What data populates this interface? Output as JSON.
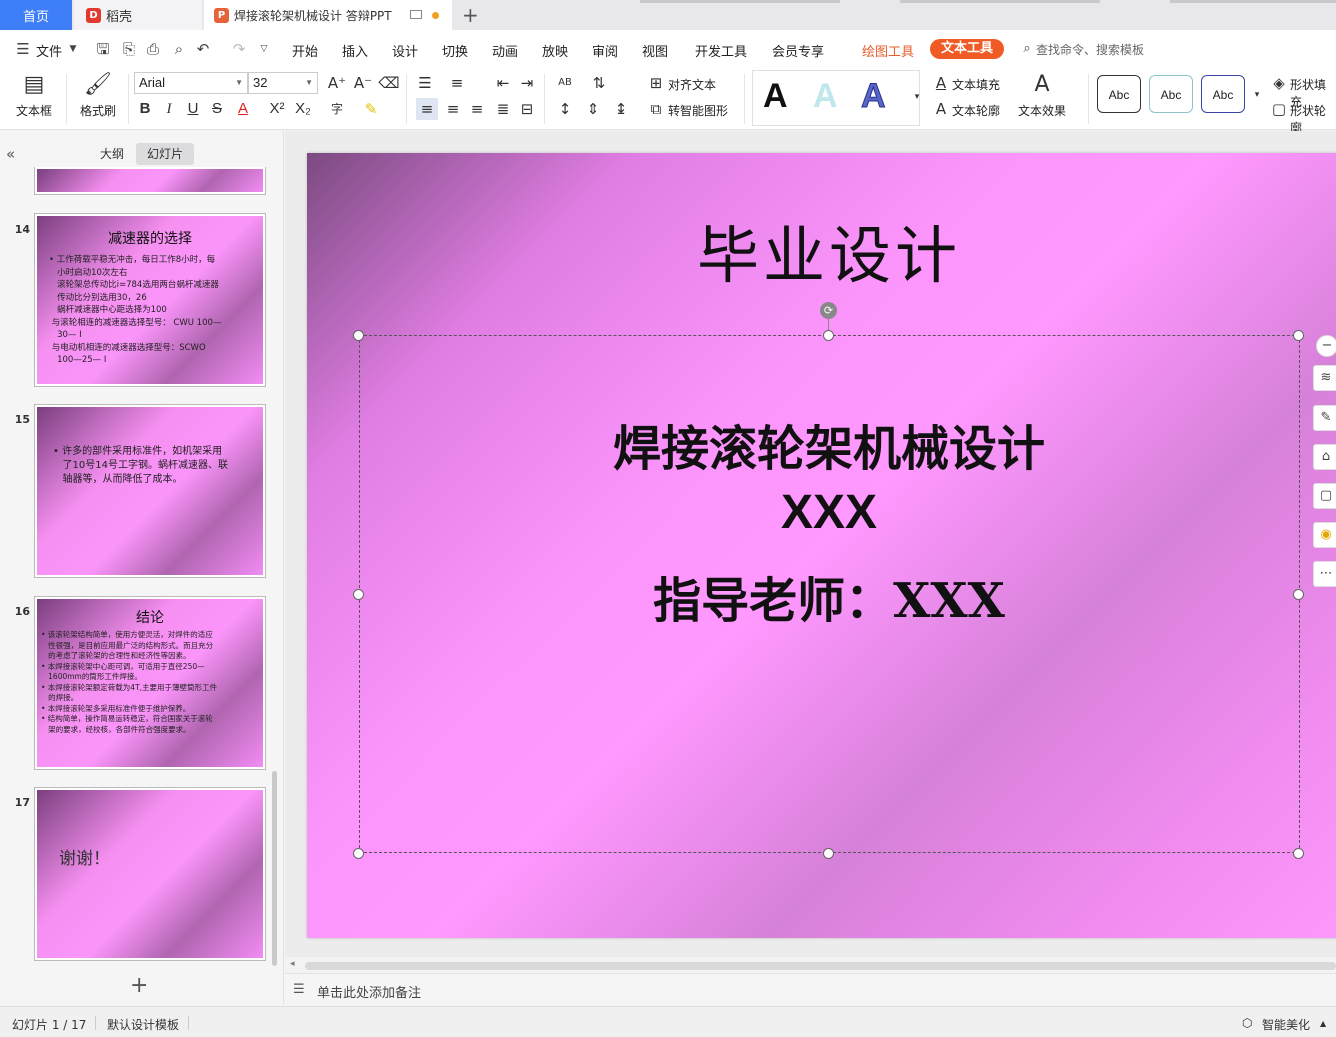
{
  "tabs": {
    "home": "首页",
    "daoke": "稻壳",
    "doc": "焊接滚轮架机械设计 答辩PPT"
  },
  "menu": {
    "file": "文件",
    "items": [
      "开始",
      "插入",
      "设计",
      "切换",
      "动画",
      "放映",
      "审阅",
      "视图",
      "开发工具",
      "会员专享"
    ],
    "drawing_tools": "绘图工具",
    "text_tools": "文本工具",
    "search": "查找命令、搜索模板"
  },
  "ribbon": {
    "textbox": "文本框",
    "format_painter": "格式刷",
    "font_name": "Arial",
    "font_size": "32",
    "align_text": "对齐文本",
    "smart_shape": "转智能图形",
    "text_fill": "文本填充",
    "text_outline": "文本轮廓",
    "text_effect": "文本效果",
    "style_letter": "A",
    "abc": "Abc",
    "shape_fill": "形状填充",
    "shape_outline": "形状轮廓"
  },
  "panel": {
    "outline_tab": "大纲",
    "slides_tab": "幻灯片",
    "slides": [
      {
        "num": "14",
        "title": "减速器的选择",
        "lines": "• 工作荷载平稳无冲击，每日工作8小时，每\n   小时启动10次左右\n   滚轮架总传动比i=784选用两台蜗杆减速器\n   传动比分别选用30，26\n   蜗杆减速器中心距选择为100\n 与滚轮相连的减速器选择型号： CWU 100—\n   30— Ⅰ\n 与电动机相连的减速器选择型号：SCWO\n   100—25— Ⅰ"
      },
      {
        "num": "15",
        "title": "",
        "lines": "• 许多的部件采用标准件，如机架采用\n   了10号14号工字钢。蜗杆减速器、联\n   轴器等，从而降低了成本。"
      },
      {
        "num": "16",
        "title": "结论",
        "lines": "• 该滚轮架结构简单，使用方便灵活，对焊件的适应\n   性很强，是目前应用最广泛的结构形式。而且充分\n   的考虑了滚轮架的合理性和经济性等因素。\n• 本焊接滚轮架中心距可调，可适用于直径250—\n   1600mm的筒形工件焊接。\n• 本焊接滚轮架额定荷载为4T,主要用于薄壁筒形工件\n   的焊接。\n• 本焊接滚轮架多采用标准件便于维护保养。\n• 结构简单，操作简易运转稳定，符合国家关于滚轮\n   架的要求，经校核，各部件符合强度要求。"
      },
      {
        "num": "17",
        "title": "",
        "lines": "谢谢！"
      }
    ]
  },
  "slide": {
    "title": "毕业设计",
    "subtitle": "焊接滚轮架机械设计",
    "author": "XXX",
    "advisor": "指导老师：XXX"
  },
  "notes_placeholder": "单击此处添加备注",
  "status": {
    "slide_count": "幻灯片 1 / 17",
    "template": "默认设计模板",
    "beautify": "智能美化"
  }
}
